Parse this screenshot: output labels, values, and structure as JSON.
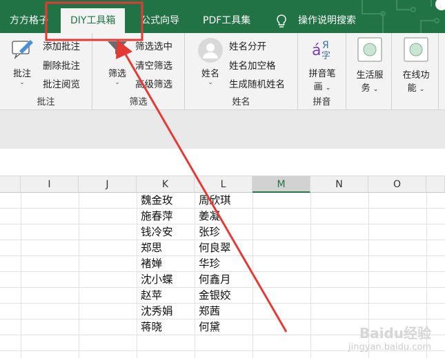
{
  "tabs": [
    {
      "label": "方方格子"
    },
    {
      "label": "DIY工具箱"
    },
    {
      "label": "公式向导"
    },
    {
      "label": "PDF工具集"
    },
    {
      "label": "操作说明搜索"
    }
  ],
  "ribbon": {
    "comment_group": {
      "big_button": "批注",
      "items": [
        "添加批注",
        "删除批注",
        "批注阅览"
      ],
      "label": "批注"
    },
    "filter_group": {
      "big_button": "筛选",
      "items": [
        "筛选选中",
        "清空筛选",
        "高级筛选"
      ],
      "label": "筛选"
    },
    "name_group": {
      "big_button": "姓名",
      "items": [
        "姓名分开",
        "姓名加空格",
        "生成随机姓名"
      ],
      "label": "姓名"
    },
    "pinyin_group": {
      "big_button_line1": "拼音笔",
      "big_button_line2": "画",
      "label": "拼音"
    },
    "life_service": {
      "line1": "生活服",
      "line2": "务"
    },
    "online": {
      "line1": "在线功",
      "line2": "能"
    }
  },
  "columns": [
    "I",
    "J",
    "K",
    "L",
    "M",
    "N",
    "O"
  ],
  "column_k": [
    "魏金玫",
    "施春萍",
    "钱冷安",
    "郑思",
    "褚婵",
    "沈小蝶",
    "赵苹",
    "沈秀娟",
    "蒋晓"
  ],
  "column_l": [
    "周欣琪",
    "姜凝",
    "张珍",
    "何良翠",
    "华珍",
    "何鑫月",
    "金银姣",
    "郑茜",
    "何黛"
  ],
  "watermark": {
    "brand": "Baidu经验",
    "url": "jingyan.baidu.com"
  },
  "colors": {
    "excel_green": "#217346",
    "highlight_red": "#e53935"
  }
}
